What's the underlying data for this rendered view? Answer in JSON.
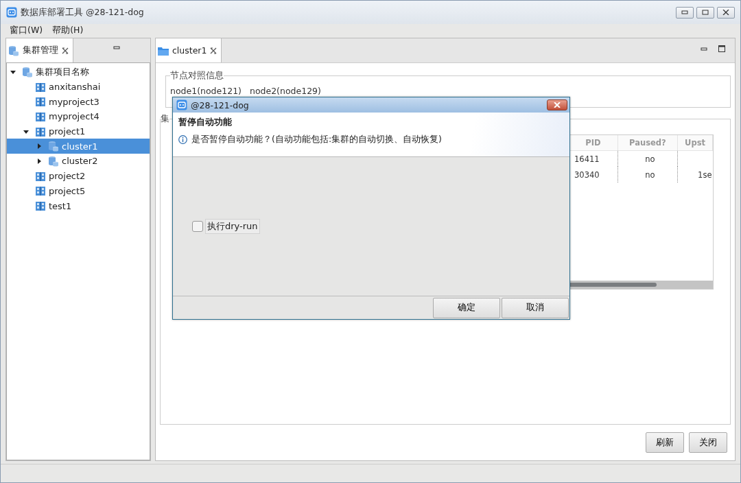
{
  "window": {
    "title": "数据库部署工具 @28-121-dog"
  },
  "menu": [
    {
      "label": "窗口(W)"
    },
    {
      "label": "帮助(H)"
    }
  ],
  "left_panel": {
    "tab": {
      "label": "集群管理",
      "selected": true
    },
    "tree": [
      {
        "label": "集群项目名称",
        "kind": "root",
        "expanded": true,
        "selected": false,
        "children": [
          {
            "label": "anxitanshai",
            "kind": "project",
            "selected": false
          },
          {
            "label": "myproject3",
            "kind": "project",
            "selected": false
          },
          {
            "label": "myproject4",
            "kind": "project",
            "selected": false
          },
          {
            "label": "project1",
            "kind": "project",
            "expanded": true,
            "selected": false,
            "children": [
              {
                "label": "cluster1",
                "kind": "cluster",
                "expanded": false,
                "selected": true
              },
              {
                "label": "cluster2",
                "kind": "cluster",
                "expanded": false,
                "selected": false
              }
            ]
          },
          {
            "label": "project2",
            "kind": "project",
            "selected": false
          },
          {
            "label": "project5",
            "kind": "project",
            "selected": false
          },
          {
            "label": "test1",
            "kind": "project",
            "selected": false
          }
        ]
      }
    ]
  },
  "editor": {
    "tab": {
      "label": "cluster1",
      "selected": true
    },
    "node_group": {
      "title": "节点对照信息",
      "nodes": [
        "node1(node121)",
        "node2(node129)"
      ]
    },
    "cluster_group": {
      "title": "集"
    },
    "table": {
      "columns": [
        "PID",
        "Paused?",
        "Upst"
      ],
      "rows": [
        {
          "pid": "16411",
          "paused": "no"
        },
        {
          "pid": "30340",
          "paused": "no",
          "column_3": "1se"
        }
      ]
    },
    "buttons": [
      "刷新",
      "关闭"
    ]
  },
  "dialog": {
    "title": "@28-121-dog",
    "heading": "暂停自动功能",
    "message": "是否暂停自动功能？(自动功能包括:集群的自动切换、自动恢复)",
    "checkbox": {
      "label": "执行dry-run",
      "checked": false
    },
    "buttons": [
      "确定",
      "取消"
    ]
  }
}
